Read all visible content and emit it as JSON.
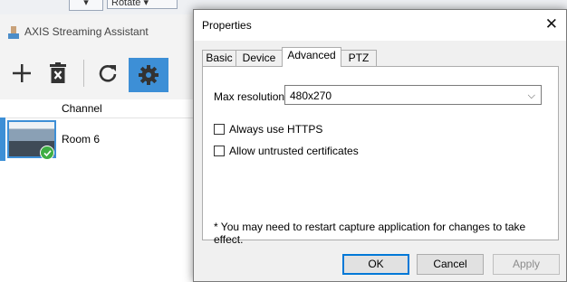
{
  "background": {
    "rotate_label": "Rotate"
  },
  "app": {
    "title": "AXIS Streaming Assistant",
    "toolbar_icons": [
      "plus-icon",
      "delete-icon",
      "refresh-icon",
      "settings-icon"
    ],
    "column_header": "Channel",
    "channels": [
      {
        "name": "Room 6",
        "status": "connected"
      }
    ],
    "colors": {
      "accent": "#3d8fd6",
      "ok": "#3eae43"
    }
  },
  "dialog": {
    "title": "Properties",
    "close_glyph": "✕",
    "tabs": [
      "Basic",
      "Device",
      "Advanced",
      "PTZ"
    ],
    "active_tab": "Advanced",
    "max_resolution_label": "Max resolution:",
    "max_resolution_value": "480x270",
    "always_https_label": "Always use HTTPS",
    "always_https_checked": false,
    "allow_untrusted_label": "Allow untrusted certificates",
    "allow_untrusted_checked": false,
    "note": "* You may need to restart capture application for changes to take effect.",
    "buttons": {
      "ok": "OK",
      "cancel": "Cancel",
      "apply": "Apply"
    }
  }
}
